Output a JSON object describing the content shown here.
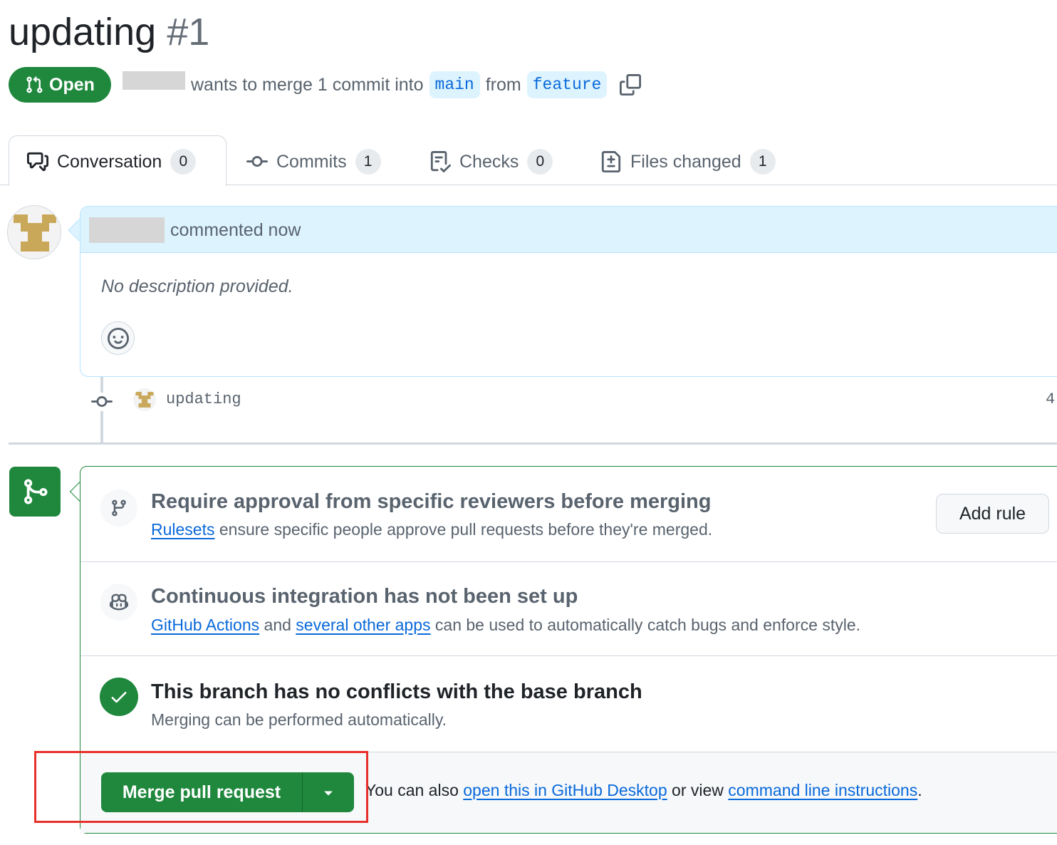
{
  "pr": {
    "title": "updating",
    "number": "#1",
    "state": "Open",
    "meta_text": "wants to merge 1 commit into",
    "base_branch": "main",
    "from_text": "from",
    "head_branch": "feature"
  },
  "tabs": [
    {
      "label": "Conversation",
      "count": "0",
      "icon": "comment-discussion-icon"
    },
    {
      "label": "Commits",
      "count": "1",
      "icon": "git-commit-icon"
    },
    {
      "label": "Checks",
      "count": "0",
      "icon": "checklist-icon"
    },
    {
      "label": "Files changed",
      "count": "1",
      "icon": "file-diff-icon"
    }
  ],
  "comment": {
    "action": "commented now",
    "body": "No description provided."
  },
  "commit": {
    "message": "updating",
    "sha_fragment": "4"
  },
  "merge": {
    "rule_title": "Require approval from specific reviewers before merging",
    "rule_link": "Rulesets",
    "rule_desc": "ensure specific people approve pull requests before they're merged.",
    "add_rule": "Add rule",
    "ci_title": "Continuous integration has not been set up",
    "ci_link1": "GitHub Actions",
    "ci_and": "and",
    "ci_link2": "several other apps",
    "ci_desc": "can be used to automatically catch bugs and enforce style.",
    "conflict_title": "This branch has no conflicts with the base branch",
    "conflict_desc": "Merging can be performed automatically.",
    "merge_button": "Merge pull request",
    "footer_prefix": "You can also",
    "footer_link1": "open this in GitHub Desktop",
    "footer_mid": "or view",
    "footer_link2": "command line instructions",
    "footer_suffix": "."
  },
  "colors": {
    "success": "#1f883d",
    "link": "#0969da",
    "highlight": "#e8302a"
  }
}
